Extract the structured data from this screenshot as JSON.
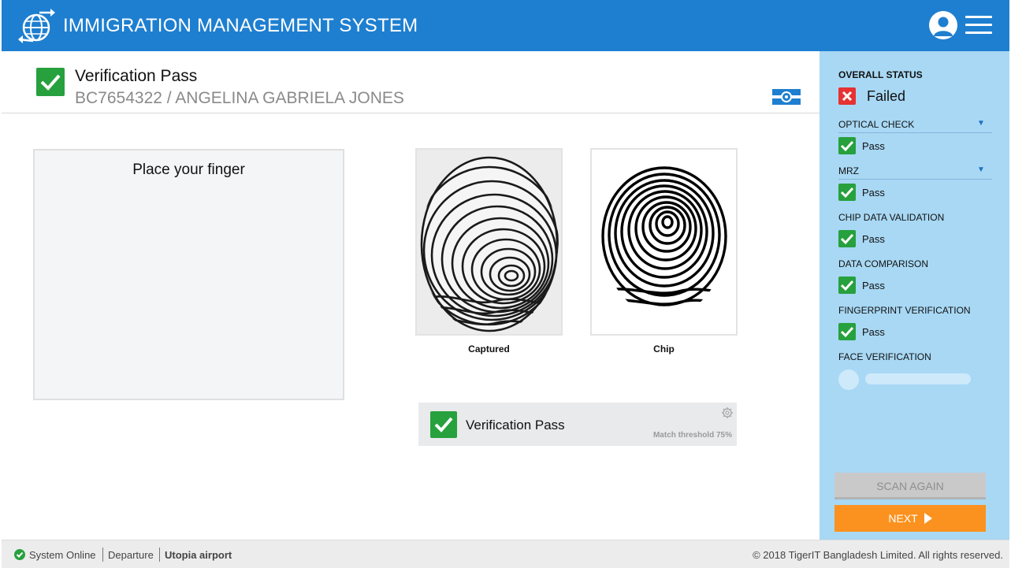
{
  "header": {
    "title": "IMMIGRATION MANAGEMENT SYSTEM"
  },
  "verification": {
    "title": "Verification Pass",
    "subtitle": "BC7654322 / ANGELINA GABRIELA JONES"
  },
  "finger_panel": {
    "label": "Place your finger"
  },
  "prints": {
    "captured_label": "Captured",
    "chip_label": "Chip"
  },
  "result": {
    "label": "Verification Pass",
    "threshold": "Match threshold 75%"
  },
  "sidebar": {
    "overall_label": "OVERALL STATUS",
    "overall_value": "Failed",
    "checks": [
      {
        "label": "OPTICAL CHECK",
        "status": "Pass"
      },
      {
        "label": "MRZ",
        "status": "Pass"
      },
      {
        "label": "CHIP DATA VALIDATION",
        "status": "Pass"
      },
      {
        "label": "DATA COMPARISON",
        "status": "Pass"
      },
      {
        "label": "FINGERPRINT VERIFICATION",
        "status": "Pass"
      }
    ],
    "face_label": "FACE VERIFICATION",
    "scan_again": "SCAN AGAIN",
    "next": "NEXT"
  },
  "footer": {
    "status": "System Online",
    "mode": "Departure",
    "location": "Utopia airport",
    "copyright": "© 2018 TigerIT Bangladesh Limited. All rights reserved."
  },
  "colors": {
    "header": "#1e7fd0",
    "sidebar": "#a8d8f4",
    "pass": "#27a03e",
    "fail": "#e63232",
    "next": "#fb921f"
  }
}
